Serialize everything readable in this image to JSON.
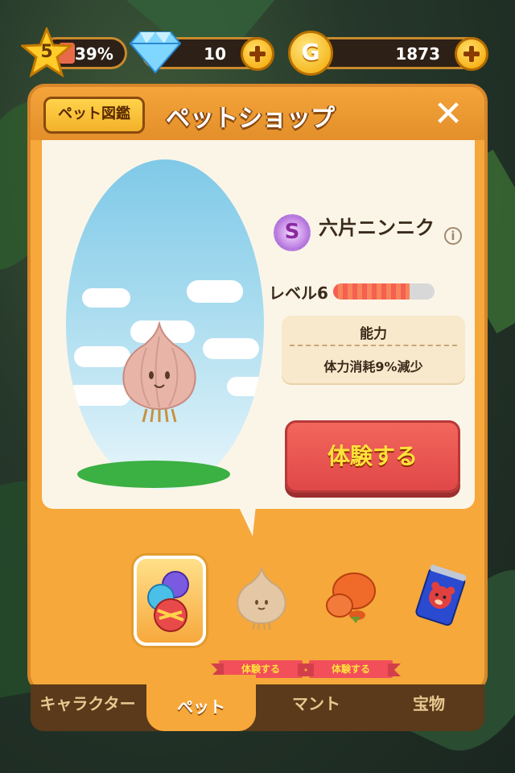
{
  "hud": {
    "level": "5",
    "exp_percent_label": "39%",
    "exp_fraction": 0.39,
    "gems": "10",
    "coin_symbol": "G",
    "coins": "1873"
  },
  "shop": {
    "dex_button": "ペット図鑑",
    "title": "ペットショップ",
    "close_symbol": "✕"
  },
  "pet": {
    "rank": "S",
    "name": "六片ニンニク",
    "info_symbol": "i",
    "level_label": "レベル6",
    "level_progress": 0.75,
    "ability_title": "能力",
    "ability_desc": "体力消耗9%減少",
    "try_button": "体験する"
  },
  "pet_list": {
    "items": [
      {
        "icon": "candy-jar-icon",
        "selected": true
      },
      {
        "icon": "garlic-icon",
        "selected": false
      },
      {
        "icon": "orange-creature-icon",
        "selected": false
      },
      {
        "icon": "bear-can-icon",
        "selected": false
      }
    ],
    "ribbon_label": "体験する"
  },
  "tabs": [
    {
      "label": "キャラクター",
      "active": false
    },
    {
      "label": "ペット",
      "active": true
    },
    {
      "label": "マント",
      "active": false
    },
    {
      "label": "宝物",
      "active": false
    }
  ],
  "colors": {
    "panel": "#f6a83a",
    "card": "#fbf5e8",
    "try_button": "#e04848",
    "try_text": "#ffe23a"
  }
}
